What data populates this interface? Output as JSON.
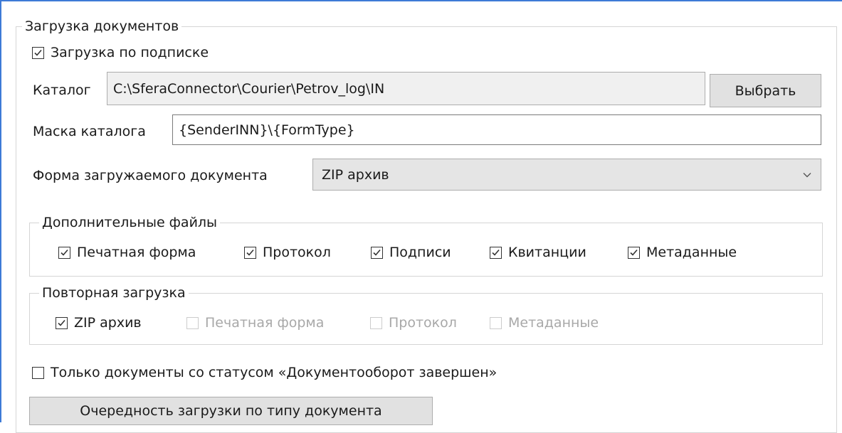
{
  "group_main": {
    "legend": "Загрузка документов"
  },
  "subscription": {
    "label": "Загрузка по подписке",
    "checked": true
  },
  "catalog": {
    "label": "Каталог",
    "value": "C:\\SferaConnector\\Courier\\Petrov_log\\IN",
    "browse_label": "Выбрать"
  },
  "catalog_mask": {
    "label": "Маска каталога",
    "value": "{SenderINN}\\{FormType}"
  },
  "doc_form": {
    "label": "Форма загружаемого документа",
    "selected": "ZIP архив",
    "icon": "chevron-down-icon"
  },
  "additional_files": {
    "legend": "Дополнительные файлы",
    "items": [
      {
        "label": "Печатная форма",
        "checked": true
      },
      {
        "label": "Протокол",
        "checked": true
      },
      {
        "label": "Подписи",
        "checked": true
      },
      {
        "label": "Квитанции",
        "checked": true
      },
      {
        "label": "Метаданные",
        "checked": true
      }
    ]
  },
  "reload": {
    "legend": "Повторная загрузка",
    "items": [
      {
        "label": "ZIP архив",
        "checked": true,
        "enabled": true
      },
      {
        "label": "Печатная форма",
        "checked": false,
        "enabled": false
      },
      {
        "label": "Протокол",
        "checked": false,
        "enabled": false
      },
      {
        "label": "Метаданные",
        "checked": false,
        "enabled": false
      }
    ]
  },
  "only_completed": {
    "label": "Только документы со статусом «Документооборот завершен»",
    "checked": false
  },
  "order_button": {
    "label": "Очередность загрузки по типу документа"
  },
  "colors": {
    "frame_accent": "#3d7ad6",
    "group_border": "#d5d5d5",
    "disabled_text": "#a8a8a8"
  }
}
